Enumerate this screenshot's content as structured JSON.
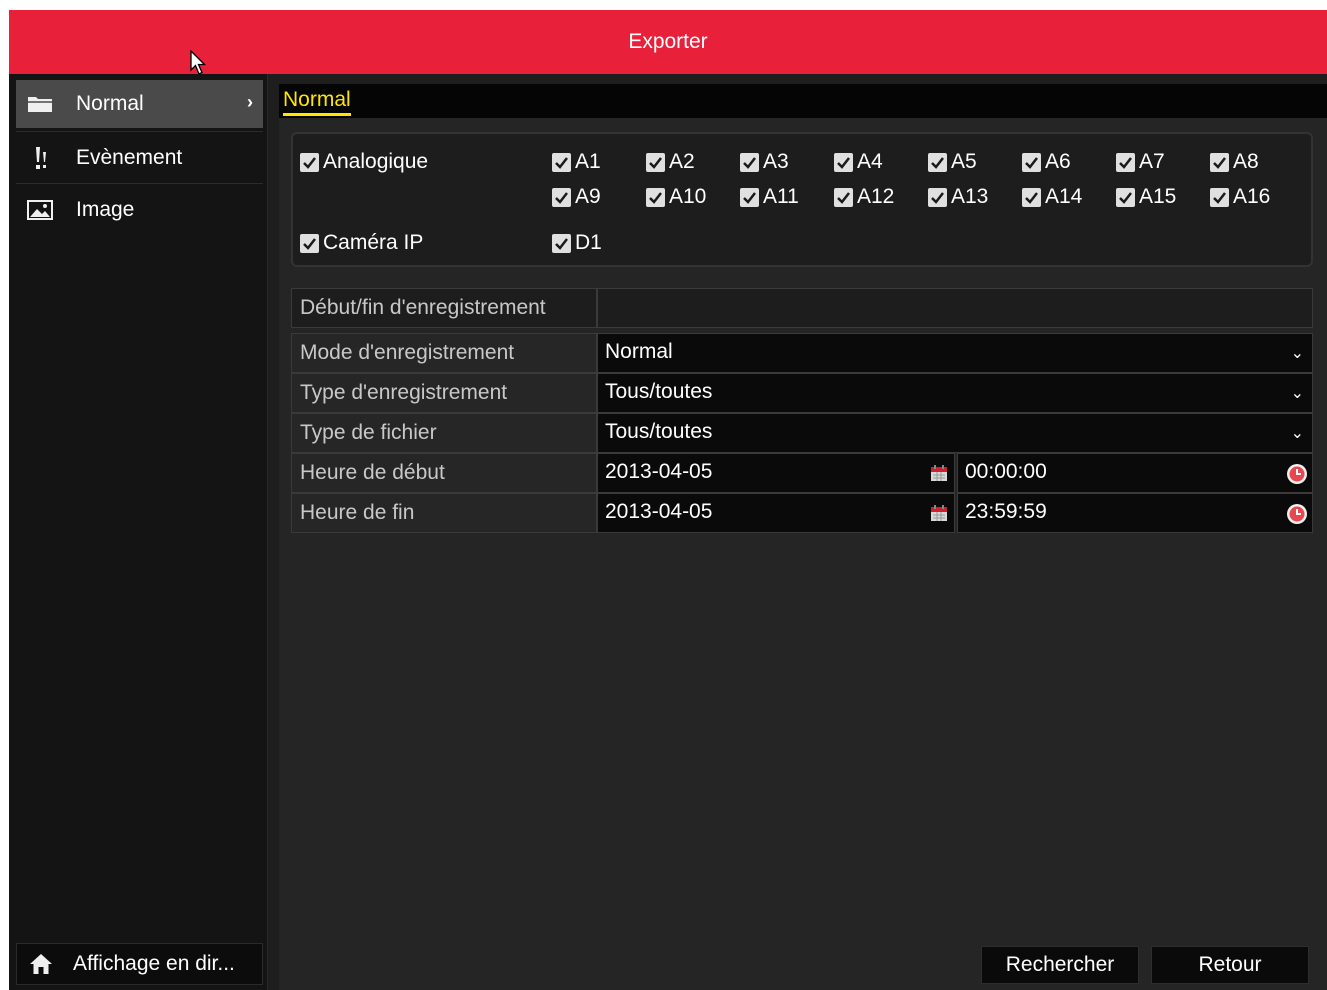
{
  "window": {
    "title": "Exporter"
  },
  "sidebar": {
    "items": [
      {
        "label": "Normal",
        "icon": "folder-icon",
        "active": true
      },
      {
        "label": "Evènement",
        "icon": "exclamation-icon",
        "active": false
      },
      {
        "label": "Image",
        "icon": "picture-icon",
        "active": false
      }
    ],
    "home_label": "Affichage en dir..."
  },
  "tabs": [
    {
      "label": "Normal",
      "active": true
    }
  ],
  "channels": {
    "analog_label": "Analogique",
    "analog": [
      "A1",
      "A2",
      "A3",
      "A4",
      "A5",
      "A6",
      "A7",
      "A8",
      "A9",
      "A10",
      "A11",
      "A12",
      "A13",
      "A14",
      "A15",
      "A16"
    ],
    "ip_label": "Caméra IP",
    "ip": [
      "D1"
    ]
  },
  "form": {
    "record_span_label": "Début/fin d'enregistrement",
    "record_span_value": "",
    "mode_label": "Mode d'enregistrement",
    "mode_value": "Normal",
    "rec_type_label": "Type d'enregistrement",
    "rec_type_value": "Tous/toutes",
    "file_type_label": "Type de fichier",
    "file_type_value": "Tous/toutes",
    "start_label": "Heure de début",
    "start_date": "2013-04-05",
    "start_time": "00:00:00",
    "end_label": "Heure de fin",
    "end_date": "2013-04-05",
    "end_time": "23:59:59"
  },
  "buttons": {
    "search": "Rechercher",
    "back": "Retour"
  },
  "colors": {
    "titlebar": "#e8203a",
    "tab_accent": "#ffe500",
    "background": "#252525"
  }
}
